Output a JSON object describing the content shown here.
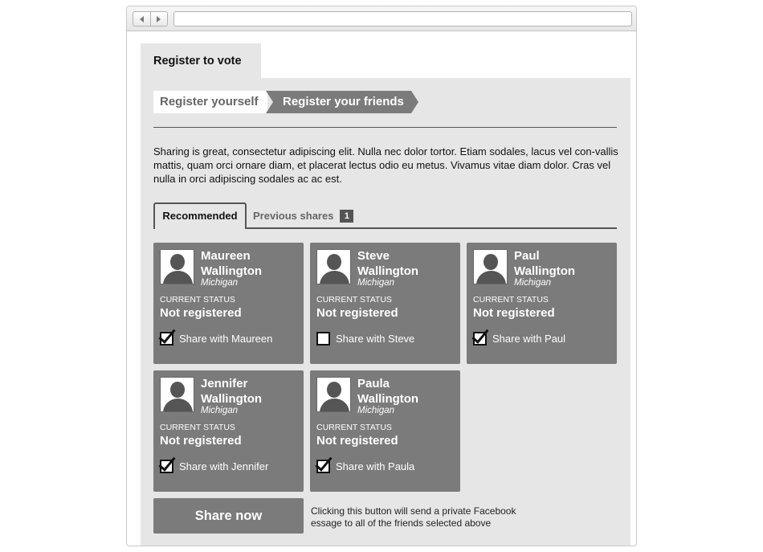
{
  "header": {
    "tab_title": "Register to vote"
  },
  "steps": [
    {
      "label": "Register yourself"
    },
    {
      "label": "Register your friends"
    }
  ],
  "intro_text": "Sharing is great, consectetur adipiscing elit. Nulla nec dolor tortor. Etiam sodales, lacus vel con-vallis mattis, quam orci ornare diam, et placerat lectus odio eu metus. Vivamus vitae diam dolor. Cras vel nulla in orci adipiscing sodales ac ac est.",
  "tabs": {
    "recommended": "Recommended",
    "previous": "Previous shares",
    "previous_count": "1"
  },
  "friends": [
    {
      "first": "Maureen",
      "last": "Wallington",
      "state": "Michigan",
      "status_label": "CURRENT STATUS",
      "status": "Not registered",
      "share_label": "Share with Maureen",
      "checked": true
    },
    {
      "first": "Steve",
      "last": "Wallington",
      "state": "Michigan",
      "status_label": "CURRENT STATUS",
      "status": "Not registered",
      "share_label": "Share with Steve",
      "checked": false
    },
    {
      "first": "Paul",
      "last": "Wallington",
      "state": "Michigan",
      "status_label": "CURRENT STATUS",
      "status": "Not registered",
      "share_label": "Share with Paul",
      "checked": true
    },
    {
      "first": "Jennifer",
      "last": "Wallington",
      "state": "Michigan",
      "status_label": "CURRENT STATUS",
      "status": "Not registered",
      "share_label": "Share with Jennifer",
      "checked": true
    },
    {
      "first": "Paula",
      "last": "Wallington",
      "state": "Michigan",
      "status_label": "CURRENT STATUS",
      "status": "Not registered",
      "share_label": "Share with Paula",
      "checked": true
    }
  ],
  "share_button": "Share now",
  "share_note": "Clicking this button will send a private Facebook essage to all of the friends selected above",
  "colors": {
    "card": "#7b7b7b",
    "panel": "#e6e6e6",
    "text_dark": "#111111"
  }
}
